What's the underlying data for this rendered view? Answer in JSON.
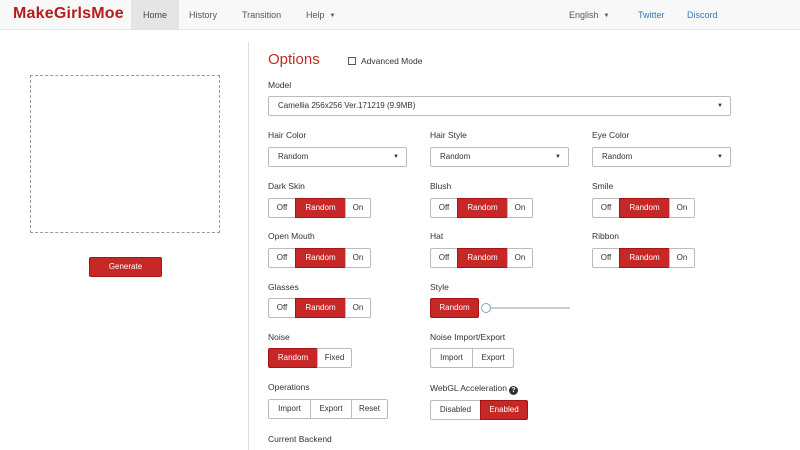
{
  "navbar": {
    "brand": "MakeGirlsMoe",
    "items": [
      {
        "label": "Home"
      },
      {
        "label": "History"
      },
      {
        "label": "Transition"
      },
      {
        "label": "Help"
      }
    ],
    "language": "English",
    "twitter": "Twitter",
    "discord": "Discord"
  },
  "left": {
    "generate_label": "Generate"
  },
  "options": {
    "title": "Options",
    "advanced_mode": "Advanced Mode",
    "model": {
      "label": "Model",
      "value": "Camellia 256x256 Ver.171219 (9.9MB)"
    },
    "hair_color": {
      "label": "Hair Color",
      "value": "Random"
    },
    "hair_style": {
      "label": "Hair Style",
      "value": "Random"
    },
    "eye_color": {
      "label": "Eye Color",
      "value": "Random"
    },
    "dark_skin": {
      "label": "Dark Skin",
      "opts": [
        "Off",
        "Random",
        "On"
      ],
      "selected": "Random"
    },
    "blush": {
      "label": "Blush",
      "opts": [
        "Off",
        "Random",
        "On"
      ],
      "selected": "Random"
    },
    "smile": {
      "label": "Smile",
      "opts": [
        "Off",
        "Random",
        "On"
      ],
      "selected": "Random"
    },
    "open_mouth": {
      "label": "Open Mouth",
      "opts": [
        "Off",
        "Random",
        "On"
      ],
      "selected": "Random"
    },
    "hat": {
      "label": "Hat",
      "opts": [
        "Off",
        "Random",
        "On"
      ],
      "selected": "Random"
    },
    "ribbon": {
      "label": "Ribbon",
      "opts": [
        "Off",
        "Random",
        "On"
      ],
      "selected": "Random"
    },
    "glasses": {
      "label": "Glasses",
      "opts": [
        "Off",
        "Random",
        "On"
      ],
      "selected": "Random"
    },
    "style": {
      "label": "Style",
      "button": "Random",
      "slider_value": 0
    },
    "noise": {
      "label": "Noise",
      "opts": [
        "Random",
        "Fixed"
      ],
      "selected": "Random"
    },
    "noise_io": {
      "label": "Noise Import/Export",
      "opts": [
        "Import",
        "Export"
      ]
    },
    "operations": {
      "label": "Operations",
      "opts": [
        "Import",
        "Export",
        "Reset"
      ]
    },
    "webgl": {
      "label": "WebGL Acceleration",
      "opts": [
        "Disabled",
        "Enabled"
      ],
      "selected": "Enabled"
    },
    "backend": {
      "label": "Current Backend"
    }
  },
  "colors": {
    "accent": "#c62828",
    "brand": "#b71c1c",
    "link": "#337ab7"
  }
}
